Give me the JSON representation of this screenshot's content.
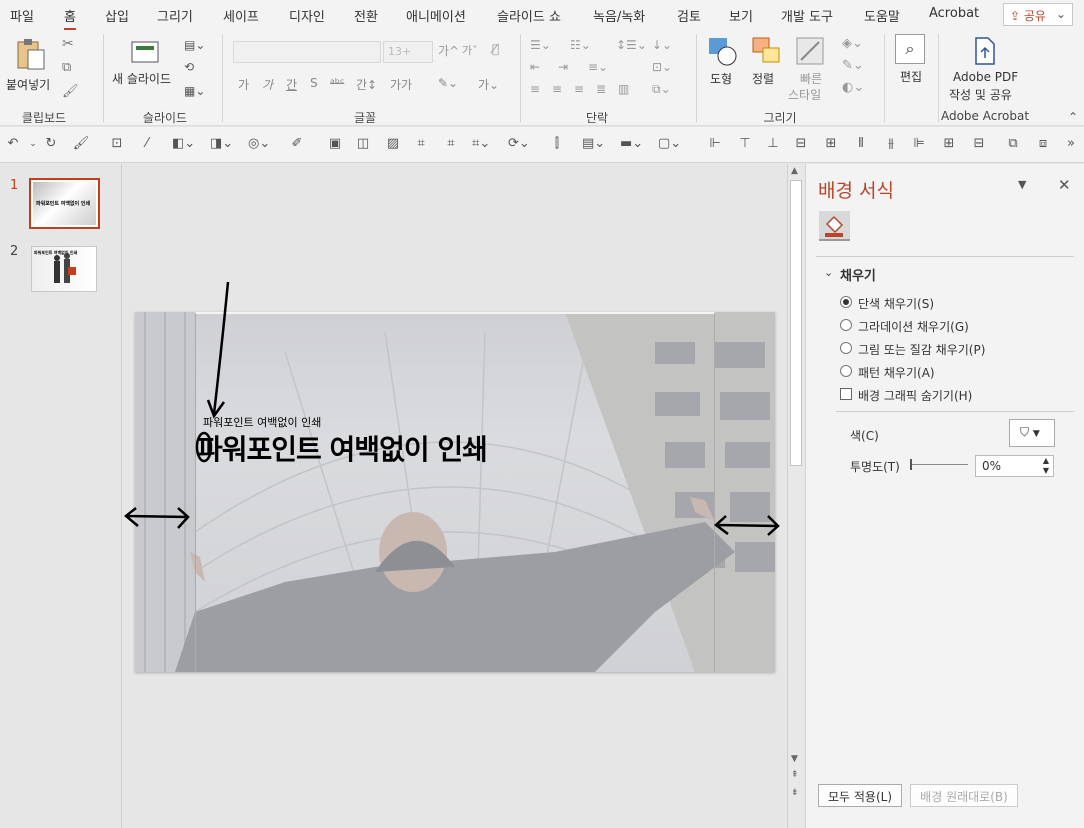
{
  "menu": {
    "tabs": [
      "파일",
      "홈",
      "삽입",
      "그리기",
      "세이프",
      "디자인",
      "전환",
      "애니메이션",
      "슬라이드 쇼",
      "녹음/녹화",
      "검토",
      "보기",
      "개발 도구",
      "도움말",
      "Acrobat"
    ],
    "active": "홈",
    "share_label": "공유"
  },
  "ribbon": {
    "groups": {
      "clipboard": "클립보드",
      "slides": "슬라이드",
      "font": "글꼴",
      "paragraph": "단락",
      "drawing": "그리기",
      "adobe": "Adobe Acrobat"
    },
    "paste_label": "붙여넣기",
    "new_slide_label": "새 슬라이드",
    "font_size_placeholder": "13+",
    "shape_label": "도형",
    "arrange_label": "정렬",
    "quick_style_label1": "빠른",
    "quick_style_label2": "스타일",
    "edit_label": "편집",
    "adobe_pdf_label1": "Adobe PDF",
    "adobe_pdf_label2": "작성 및 공유",
    "font_buttons": [
      "가",
      "가",
      "간",
      "S",
      "ᵃᵇᶜ",
      "간↕",
      "가가"
    ]
  },
  "thumbnails": [
    {
      "number": "1",
      "title": "파워포인트 여백없이 인쇄"
    },
    {
      "number": "2",
      "title": "파워포인트 여백없이 인쇄"
    }
  ],
  "slide": {
    "small_title": "파워포인트 여백없이 인쇄",
    "big_title": "파워포인트 여백없이 인쇄"
  },
  "format_pane": {
    "title": "배경 서식",
    "section": "채우기",
    "options": [
      "단색 채우기(S)",
      "그라데이션 채우기(G)",
      "그림 또는 질감 채우기(P)",
      "패턴 채우기(A)"
    ],
    "selected": "단색 채우기(S)",
    "hide_graphics": "배경 그래픽 숨기기(H)",
    "color_label": "색(C)",
    "transparency_label": "투명도(T)",
    "transparency_value": "0%",
    "apply_all": "모두 적용(L)",
    "reset": "배경 원래대로(B)"
  },
  "colors": {
    "accent": "#b7472a",
    "selection": "#c43e1c"
  }
}
